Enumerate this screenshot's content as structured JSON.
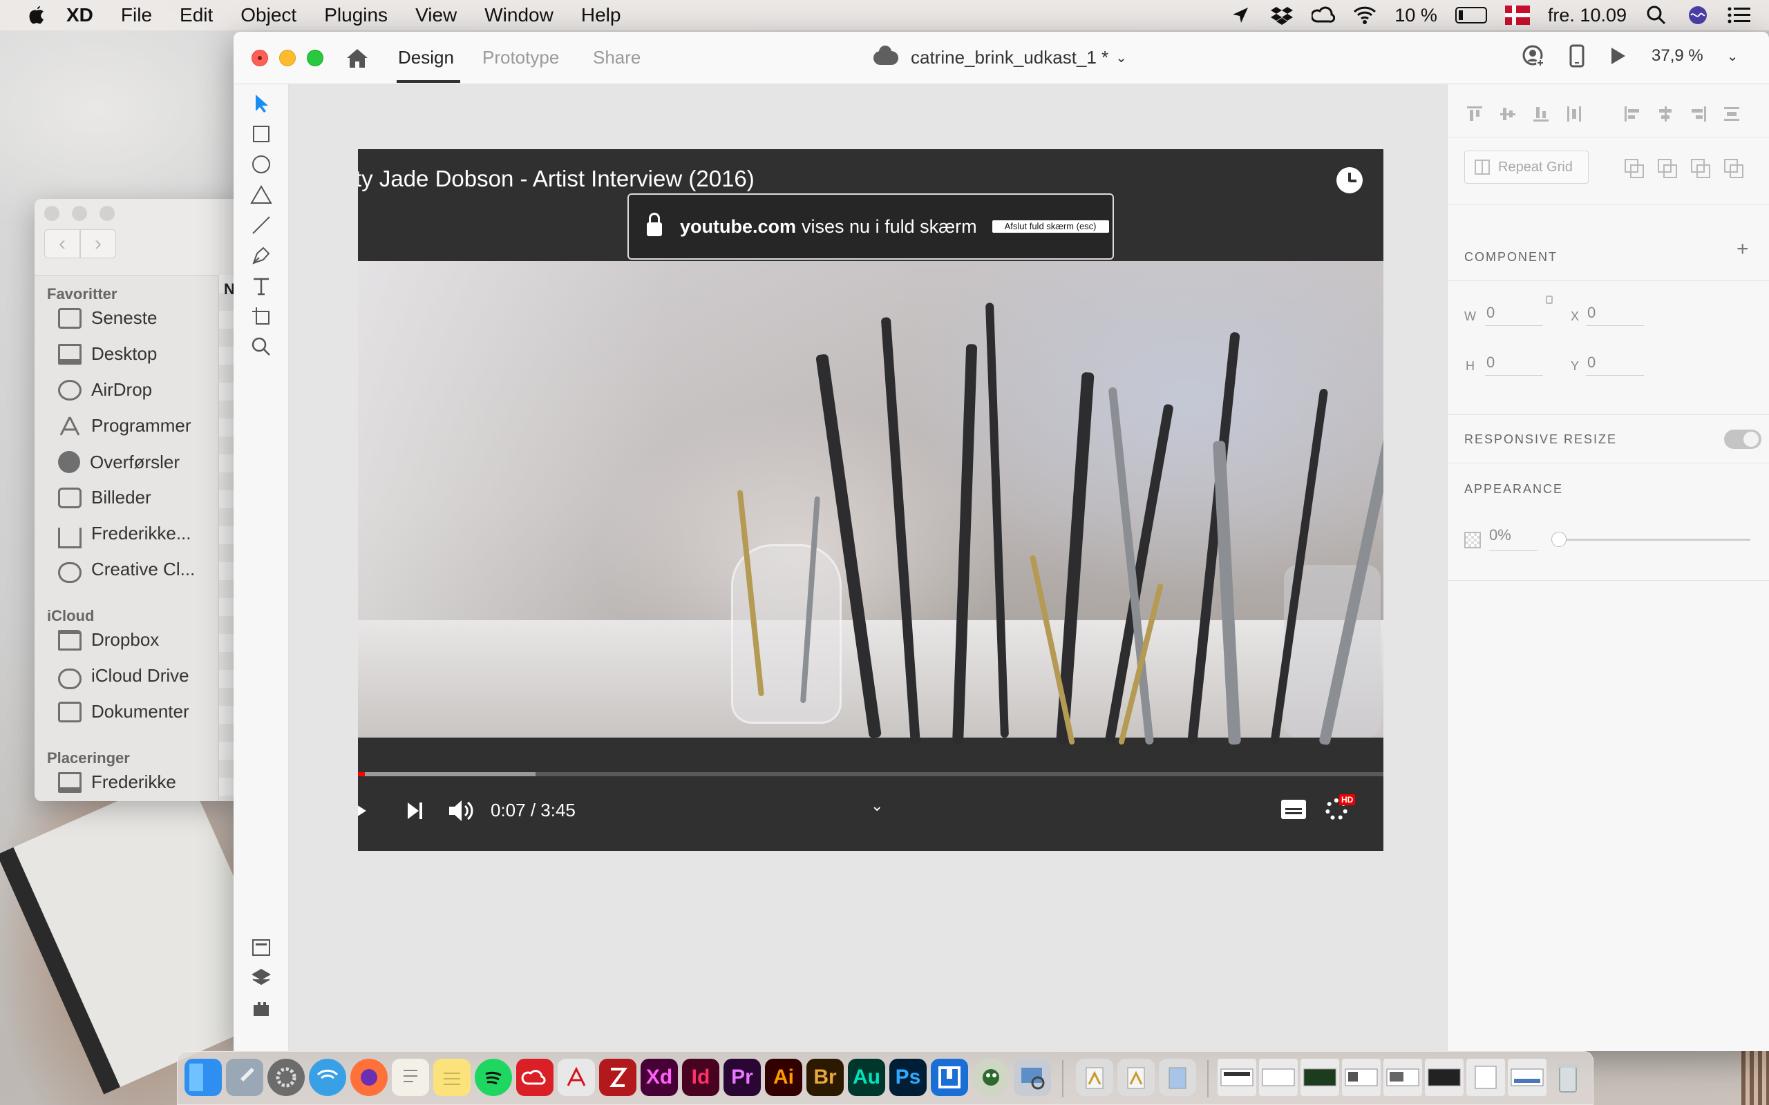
{
  "menubar": {
    "app_name": "XD",
    "items": [
      "File",
      "Edit",
      "Object",
      "Plugins",
      "View",
      "Window",
      "Help"
    ],
    "battery": "10 %",
    "clock": "fre. 10.09"
  },
  "finder": {
    "favorites_heading": "Favoritter",
    "favorites": [
      "Seneste",
      "Desktop",
      "AirDrop",
      "Programmer",
      "Overførsler",
      "Billeder",
      "Frederikke...",
      "Creative Cl..."
    ],
    "icloud_heading": "iCloud",
    "icloud": [
      "Dropbox",
      "iCloud Drive",
      "Dokumenter"
    ],
    "locations_heading": "Placeringer",
    "locations": [
      "Frederikke"
    ],
    "column_header": "N"
  },
  "xd": {
    "tabs": [
      "Design",
      "Prototype",
      "Share"
    ],
    "active_tab": "Design",
    "document_title": "catrine_brink_udkast_1 *",
    "zoom": "37,9 %"
  },
  "video": {
    "title": "ty Jade Dobson - Artist Interview (2016)",
    "notice_domain": "youtube.com",
    "notice_text": "vises nu i fuld skærm",
    "exit_fullscreen_label": "Afslut fuld skærm (esc)",
    "time": "0:07 / 3:45",
    "hd_badge": "HD",
    "progress_played_fraction": 0.007,
    "progress_buffered_fraction": 0.173
  },
  "panel": {
    "repeat_grid_label": "Repeat Grid",
    "component_heading": "COMPONENT",
    "component_add": "+",
    "w_label": "W",
    "w_value": "0",
    "x_label": "X",
    "x_value": "0",
    "h_label": "H",
    "h_value": "0",
    "y_label": "Y",
    "y_value": "0",
    "responsive_heading": "RESPONSIVE RESIZE",
    "appearance_heading": "APPEARANCE",
    "opacity_value": "0%"
  },
  "dock": {
    "labeled_apps": [
      "Xd",
      "Id",
      "Pr",
      "Ai",
      "Br",
      "Au",
      "Ps"
    ]
  }
}
